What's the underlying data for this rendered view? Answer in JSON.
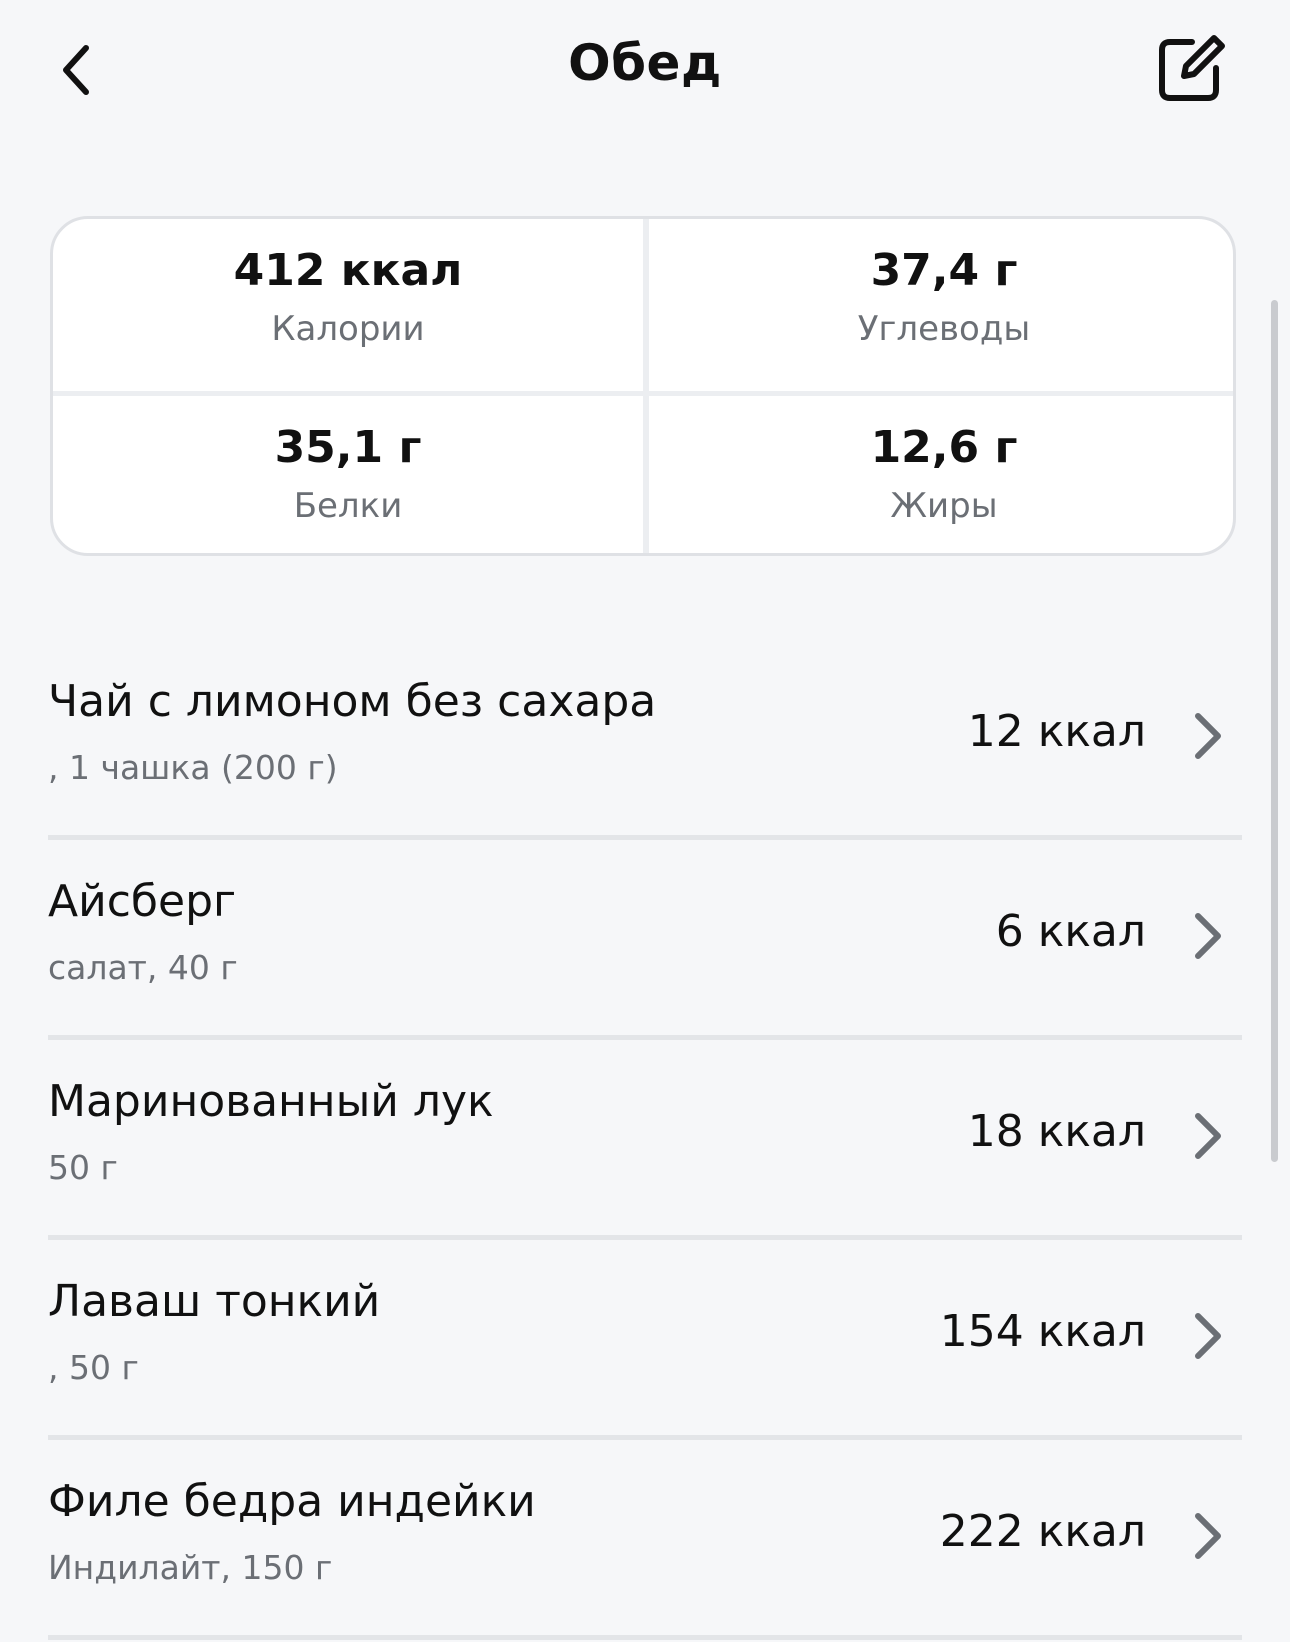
{
  "header": {
    "title": "Обед",
    "back_icon": "chevron-left-icon",
    "edit_icon": "edit-square-icon"
  },
  "summary": {
    "calories": {
      "value": "412 ккал",
      "label": "Калории"
    },
    "carbs": {
      "value": "37,4 г",
      "label": "Углеводы"
    },
    "protein": {
      "value": "35,1 г",
      "label": "Белки"
    },
    "fat": {
      "value": "12,6 г",
      "label": "Жиры"
    }
  },
  "items": [
    {
      "name": "Чай с лимоном без сахара",
      "detail": ", 1 чашка (200 г)",
      "kcal": "12 ккал"
    },
    {
      "name": "Айсберг",
      "detail": "салат, 40 г",
      "kcal": "6 ккал"
    },
    {
      "name": "Маринованный лук",
      "detail": "50 г",
      "kcal": "18 ккал"
    },
    {
      "name": "Лаваш тонкий",
      "detail": ", 50 г",
      "kcal": "154 ккал"
    },
    {
      "name": "Филе бедра индейки",
      "detail": "Индилайт, 150 г",
      "kcal": "222 ккал"
    }
  ],
  "colors": {
    "background": "#f6f7f9",
    "text": "#111111",
    "secondary_text": "#6b6f75",
    "divider": "#e3e5e8"
  }
}
